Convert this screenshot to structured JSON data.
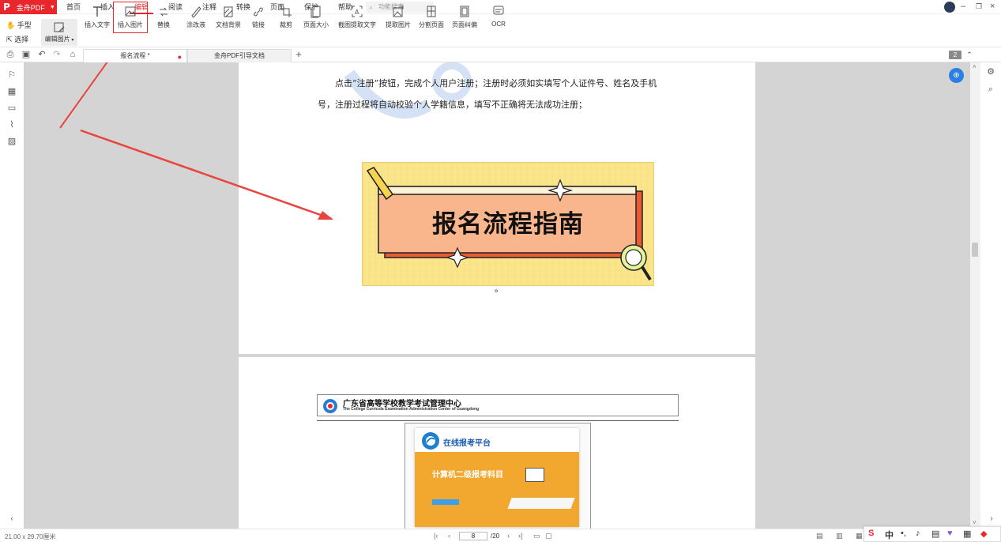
{
  "app": {
    "name": "金舟PDF",
    "accent": "#e8262b"
  },
  "menu": {
    "items": [
      "首页",
      "插入",
      "编辑",
      "阅读",
      "注释",
      "转换",
      "页面",
      "保护",
      "帮助"
    ],
    "active": "编辑",
    "search_placeholder": "功能搜索"
  },
  "toolbar": {
    "mode_hand": "手型",
    "mode_select": "选择",
    "edit_image": "编辑图片",
    "tools": [
      "插入文字",
      "插入图片",
      "替换",
      "涂改液",
      "文档背景",
      "链接",
      "裁剪",
      "页面大小",
      "截图提取文字",
      "提取图片",
      "分割页面",
      "页面纠偏",
      "OCR"
    ],
    "highlighted": "插入图片"
  },
  "tabs": {
    "items": [
      "报名流程 *",
      "金舟PDF引导文档"
    ],
    "page_badge": "2"
  },
  "document": {
    "para_line1": "点击“注册”按钮，完成个人用户注册；注册时必须如实填写个人证件号、姓名及手机",
    "para_line2": "号，注册过程将自动校验个人学籍信息，填写不正确将无法成功注册；",
    "banner_title": "报名流程指南",
    "after_banner": "。",
    "org_name": "广东省高等学校教学考试管理中心",
    "org_name_en": "The College Curricula Examination Administration Center of Guangdong",
    "platform_name": "在线报考平台",
    "platform_headline": "计算机二级报考科目"
  },
  "statusbar": {
    "page_size": "21.00 x 29.70厘米",
    "current_page": "8",
    "total_pages": "/20"
  },
  "ime": {
    "lang": "中"
  }
}
